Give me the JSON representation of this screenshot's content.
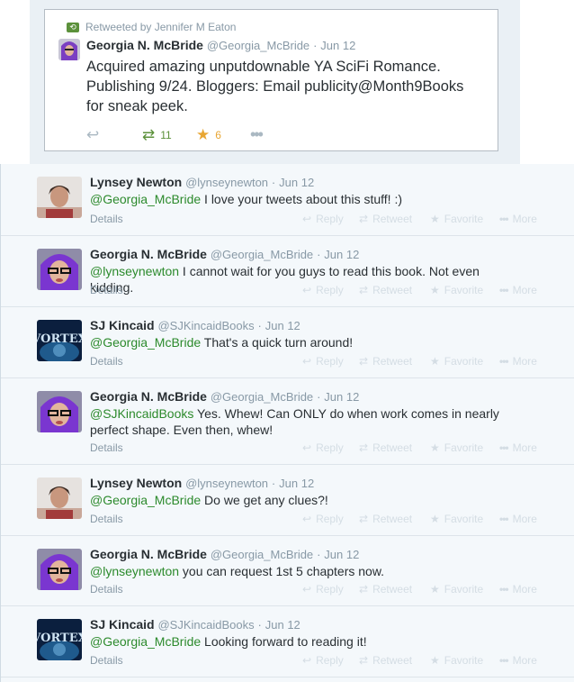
{
  "main_tweet": {
    "retweeted_by": "Retweeted by Jennifer M Eaton",
    "name": "Georgia N. McBride",
    "handle": "@Georgia_McBride",
    "sep": "·",
    "date": "Jun 12",
    "text": "Acquired amazing unputdownable YA SciFi Romance. Publishing 9/24. Bloggers: Email publicity@Month9Books for sneak peek.",
    "retweet_count": "11",
    "favorite_count": "6"
  },
  "actions": {
    "reply": "Reply",
    "retweet": "Retweet",
    "favorite": "Favorite",
    "more": "More",
    "details": "Details"
  },
  "replies": [
    {
      "name": "Lynsey Newton",
      "handle": "@lynseynewton",
      "date": "Jun 12",
      "mention": "@Georgia_McBride",
      "text": " I love your tweets about this stuff! :)"
    },
    {
      "name": "Georgia N. McBride",
      "handle": "@Georgia_McBride",
      "date": "Jun 12",
      "mention": "@lynseynewton",
      "text": " I cannot wait for you guys to read this book. Not even kidding."
    },
    {
      "name": "SJ Kincaid",
      "handle": "@SJKincaidBooks",
      "date": "Jun 12",
      "mention": "@Georgia_McBride",
      "text": " That's a quick turn around!"
    },
    {
      "name": "Georgia N. McBride",
      "handle": "@Georgia_McBride",
      "date": "Jun 12",
      "mention": "@SJKincaidBooks",
      "text": " Yes. Whew! Can ONLY do when work comes in nearly perfect shape. Even then, whew!"
    },
    {
      "name": "Lynsey Newton",
      "handle": "@lynseynewton",
      "date": "Jun 12",
      "mention": "@Georgia_McBride",
      "text": " Do we get any clues?!"
    },
    {
      "name": "Georgia N. McBride",
      "handle": "@Georgia_McBride",
      "date": "Jun 12",
      "mention": "@lynseynewton",
      "text": " you can request 1st 5 chapters now."
    },
    {
      "name": "SJ Kincaid",
      "handle": "@SJKincaidBooks",
      "date": "Jun 12",
      "mention": "@Georgia_McBride",
      "text": " Looking forward to reading it!"
    }
  ],
  "avatar_text": {
    "vortex": "VORTEX"
  },
  "colors": {
    "mention": "#2c8a2c",
    "retweet_green": "#5c913b",
    "favorite_orange": "#e8a633",
    "meta_gray": "#8899a6"
  }
}
